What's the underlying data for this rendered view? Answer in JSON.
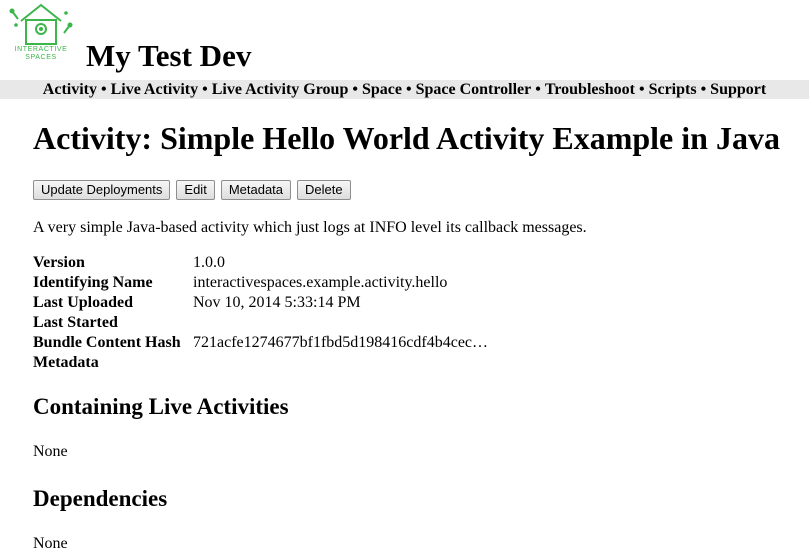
{
  "logo": {
    "line1": "INTERACTIVE",
    "line2": "SPACES",
    "color": "#3cb54a"
  },
  "header": {
    "title": "My Test Dev"
  },
  "nav": {
    "items": [
      "Activity",
      "Live Activity",
      "Live Activity Group",
      "Space",
      "Space Controller",
      "Troubleshoot",
      "Scripts",
      "Support"
    ],
    "separator": "•"
  },
  "page": {
    "title": "Activity: Simple Hello World Activity Example in Java",
    "buttons": [
      "Update Deployments",
      "Edit",
      "Metadata",
      "Delete"
    ],
    "description": "A very simple Java-based activity which just logs at INFO level its callback messages."
  },
  "properties": [
    {
      "label": "Version",
      "value": "1.0.0"
    },
    {
      "label": "Identifying Name",
      "value": "interactivespaces.example.activity.hello"
    },
    {
      "label": "Last Uploaded",
      "value": "Nov 10, 2014 5:33:14 PM"
    },
    {
      "label": "Last Started",
      "value": ""
    },
    {
      "label": "Bundle Content Hash",
      "value": "721acfe1274677bf1fbd5d198416cdf4b4cec…"
    },
    {
      "label": "Metadata",
      "value": ""
    }
  ],
  "sections": {
    "live_activities": {
      "heading": "Containing Live Activities",
      "value": "None"
    },
    "dependencies": {
      "heading": "Dependencies",
      "value": "None"
    }
  }
}
